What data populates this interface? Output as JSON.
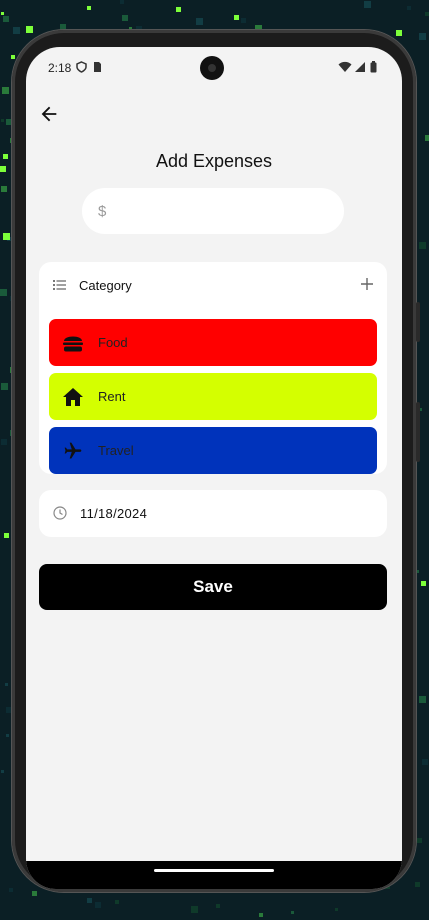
{
  "status_bar": {
    "time": "2:18"
  },
  "header": {
    "title": "Add Expenses"
  },
  "amount": {
    "prefix": "$",
    "placeholder": "",
    "value": ""
  },
  "category": {
    "label": "Category",
    "items": [
      {
        "name": "Food",
        "icon": "burger-icon",
        "color": "#ff0000"
      },
      {
        "name": "Rent",
        "icon": "home-icon",
        "color": "#d4ff00"
      },
      {
        "name": "Travel",
        "icon": "airplane-icon",
        "color": "#0033bb"
      }
    ]
  },
  "date": {
    "value": "11/18/2024"
  },
  "save_button": {
    "label": "Save"
  }
}
